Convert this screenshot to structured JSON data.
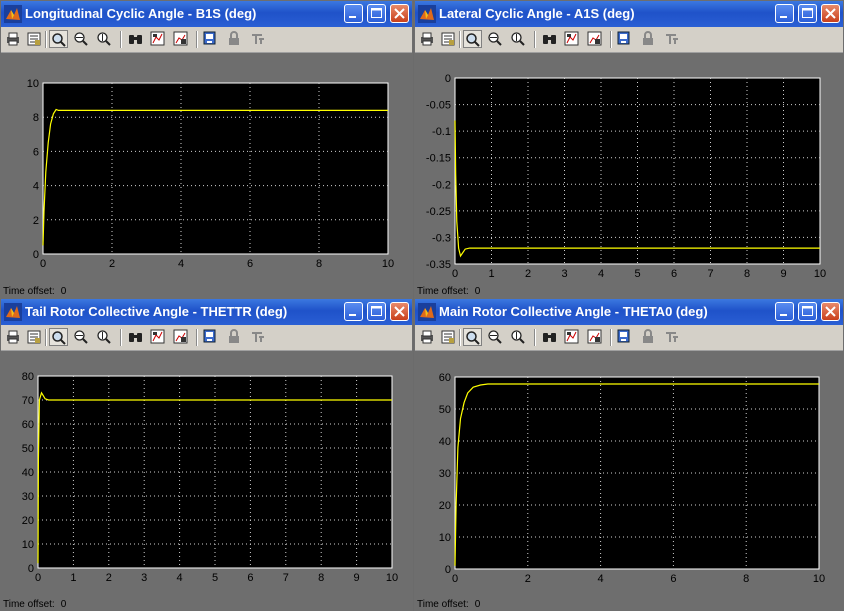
{
  "windows": [
    {
      "id": "b1s",
      "title": "Longitudinal Cyclic Angle - B1S (deg)",
      "time_offset_label": "Time offset:",
      "time_offset_value": "0",
      "chart_data": {
        "type": "line",
        "xlim": [
          0,
          10
        ],
        "ylim": [
          0,
          10
        ],
        "x_ticks": [
          "0",
          "2",
          "4",
          "6",
          "8",
          "10"
        ],
        "y_ticks": [
          "0",
          "2",
          "4",
          "6",
          "8",
          "10"
        ],
        "grid": true,
        "series": [
          {
            "color": "#ffff00",
            "x": [
              0,
              0.03,
              0.08,
              0.15,
              0.22,
              0.3,
              0.38,
              0.45,
              10
            ],
            "y": [
              0.5,
              2.5,
              4.8,
              6.5,
              7.6,
              8.2,
              8.45,
              8.4,
              8.4
            ]
          }
        ]
      }
    },
    {
      "id": "a1s",
      "title": "Lateral Cyclic Angle - A1S (deg)",
      "time_offset_label": "Time offset:",
      "time_offset_value": "0",
      "chart_data": {
        "type": "line",
        "xlim": [
          0,
          10
        ],
        "ylim": [
          -0.35,
          0
        ],
        "x_ticks": [
          "0",
          "1",
          "2",
          "3",
          "4",
          "5",
          "6",
          "7",
          "8",
          "9",
          "10"
        ],
        "y_ticks": [
          "0",
          "-0.05",
          "-0.1",
          "-0.15",
          "-0.2",
          "-0.25",
          "-0.3",
          "-0.35"
        ],
        "grid": true,
        "series": [
          {
            "color": "#ffff00",
            "x": [
              0,
              0.02,
              0.05,
              0.1,
              0.15,
              0.2,
              0.28,
              0.4,
              10
            ],
            "y": [
              -0.08,
              -0.18,
              -0.27,
              -0.32,
              -0.335,
              -0.33,
              -0.322,
              -0.32,
              -0.32
            ]
          }
        ]
      }
    },
    {
      "id": "thettr",
      "title": "Tail Rotor Collective Angle - THETTR (deg)",
      "time_offset_label": "Time offset:",
      "time_offset_value": "0",
      "chart_data": {
        "type": "line",
        "xlim": [
          0,
          10
        ],
        "ylim": [
          0,
          80
        ],
        "x_ticks": [
          "0",
          "1",
          "2",
          "3",
          "4",
          "5",
          "6",
          "7",
          "8",
          "9",
          "10"
        ],
        "y_ticks": [
          "0",
          "10",
          "20",
          "30",
          "40",
          "50",
          "60",
          "70",
          "80"
        ],
        "grid": true,
        "series": [
          {
            "color": "#ffff00",
            "x": [
              0,
              0.01,
              0.04,
              0.1,
              0.14,
              0.2,
              0.3,
              10
            ],
            "y": [
              2,
              45,
              70,
              73,
              72,
              70.5,
              70,
              70
            ]
          }
        ]
      }
    },
    {
      "id": "theta0",
      "title": "Main Rotor Collective Angle - THETA0 (deg)",
      "time_offset_label": "Time offset:",
      "time_offset_value": "0",
      "chart_data": {
        "type": "line",
        "xlim": [
          0,
          10
        ],
        "ylim": [
          0,
          60
        ],
        "x_ticks": [
          "0",
          "2",
          "4",
          "6",
          "8",
          "10"
        ],
        "y_ticks": [
          "0",
          "10",
          "20",
          "30",
          "40",
          "50",
          "60"
        ],
        "grid": true,
        "series": [
          {
            "color": "#ffff00",
            "x": [
              0,
              0.03,
              0.08,
              0.15,
              0.25,
              0.35,
              0.5,
              0.7,
              0.9,
              10
            ],
            "y": [
              1,
              20,
              38,
              47,
              52,
              55,
              56.8,
              57.5,
              57.8,
              57.8
            ]
          }
        ]
      }
    }
  ],
  "toolbar_icons": [
    "print-icon",
    "print-setup-icon",
    "zoom-icon",
    "zoom-x-icon",
    "zoom-y-icon",
    "autoscale-binoculars-icon",
    "save-axes-icon",
    "restore-axes-icon",
    "floating-scope-icon",
    "lock-axes-icon",
    "signal-selector-icon"
  ],
  "colors": {
    "background": "#000000",
    "grid": "#cfcfcf",
    "trace": "#ffff00",
    "titlebar": "#2a5fd4"
  }
}
